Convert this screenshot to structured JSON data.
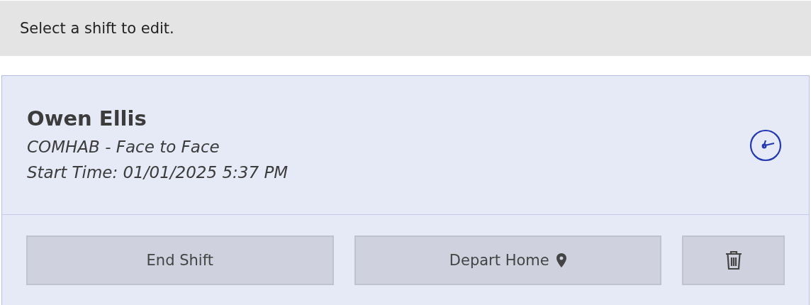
{
  "banner": {
    "text": "Select a shift to edit."
  },
  "shift": {
    "name": "Owen Ellis",
    "service": "COMHAB - Face to Face",
    "start_time": "Start Time: 01/01/2025 5:37 PM"
  },
  "buttons": [
    {
      "kind": "text",
      "label": "End Shift"
    },
    {
      "kind": "location",
      "label": "Depart Home"
    },
    {
      "kind": "delete"
    }
  ]
}
